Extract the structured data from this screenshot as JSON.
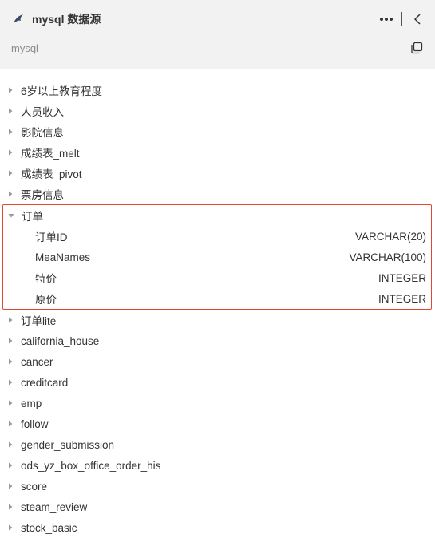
{
  "header": {
    "title": "mysql 数据源",
    "subtitle": "mysql",
    "icons": {
      "datasource": "dolphin-icon",
      "more": "more-dots-icon",
      "collapse": "chevron-left-icon",
      "copy": "copy-icon"
    }
  },
  "tables_before": [
    {
      "name": "6岁以上教育程度"
    },
    {
      "name": "人员收入"
    },
    {
      "name": "影院信息"
    },
    {
      "name": "成绩表_melt"
    },
    {
      "name": "成绩表_pivot"
    },
    {
      "name": "票房信息"
    }
  ],
  "expanded_table": {
    "name": "订单",
    "fields": [
      {
        "name": "订单ID",
        "type": "VARCHAR(20)"
      },
      {
        "name": "MeaNames",
        "type": "VARCHAR(100)"
      },
      {
        "name": "特价",
        "type": "INTEGER"
      },
      {
        "name": "原价",
        "type": "INTEGER"
      }
    ]
  },
  "tables_after": [
    {
      "name": "订单lite"
    },
    {
      "name": "california_house"
    },
    {
      "name": "cancer"
    },
    {
      "name": "creditcard"
    },
    {
      "name": "emp"
    },
    {
      "name": "follow"
    },
    {
      "name": "gender_submission"
    },
    {
      "name": "ods_yz_box_office_order_his"
    },
    {
      "name": "score"
    },
    {
      "name": "steam_review"
    },
    {
      "name": "stock_basic"
    }
  ],
  "colors": {
    "header_bg": "#f2f2f2",
    "highlight_border": "#e0482f",
    "text": "#333333",
    "muted": "#8a8a8a"
  }
}
